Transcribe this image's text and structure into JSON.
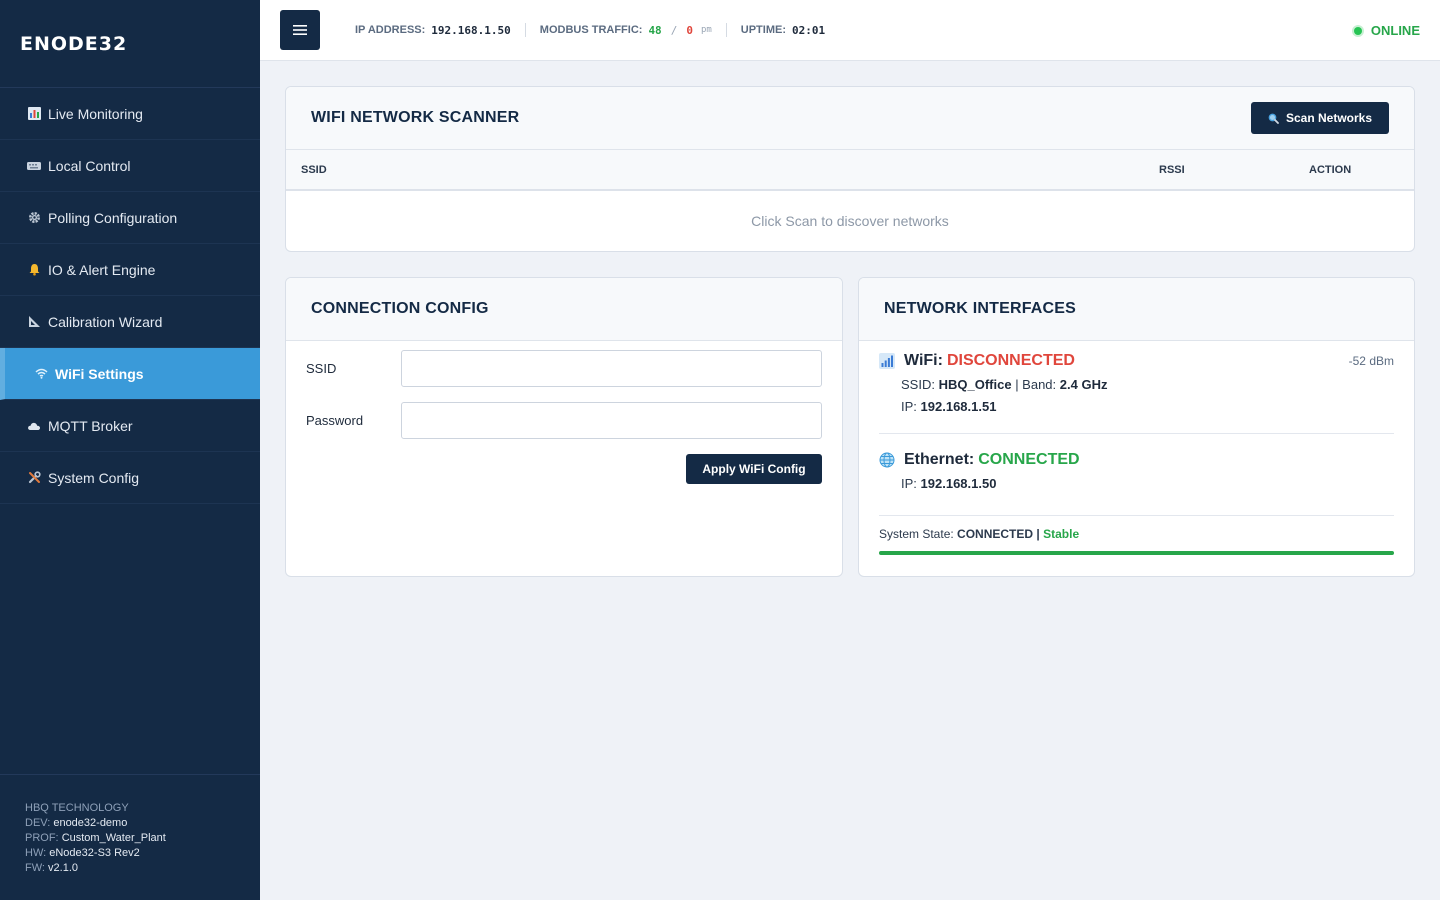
{
  "app": {
    "brand": "ENODE32"
  },
  "sidebar": {
    "items": [
      {
        "label": "Live Monitoring",
        "icon": "bar-chart-icon"
      },
      {
        "label": "Local Control",
        "icon": "keyboard-icon"
      },
      {
        "label": "Polling Configuration",
        "icon": "gear-icon"
      },
      {
        "label": "IO & Alert Engine",
        "icon": "bell-icon"
      },
      {
        "label": "Calibration Wizard",
        "icon": "triangle-ruler-icon"
      },
      {
        "label": "WiFi Settings",
        "icon": "wifi-icon",
        "active": true
      },
      {
        "label": "MQTT Broker",
        "icon": "cloud-icon"
      },
      {
        "label": "System Config",
        "icon": "tools-icon"
      }
    ],
    "footer": {
      "company": "HBQ TECHNOLOGY",
      "dev_label": "DEV:",
      "dev_value": "enode32-demo",
      "prof_label": "PROF:",
      "prof_value": "Custom_Water_Plant",
      "hw_label": "HW:",
      "hw_value": "eNode32-S3 Rev2",
      "fw_label": "FW:",
      "fw_value": "v2.1.0"
    }
  },
  "topbar": {
    "menu_icon": "hamburger-icon",
    "ip_label": "IP ADDRESS:",
    "ip_value": "192.168.1.50",
    "modbus_label": "MODBUS TRAFFIC:",
    "modbus_ok": "48",
    "modbus_slash": "/",
    "modbus_err": "0",
    "modbus_unit": "pm",
    "uptime_label": "UPTIME:",
    "uptime_value": "02:01",
    "status": "ONLINE",
    "status_color": "#27a64a"
  },
  "scanner": {
    "title": "WIFI NETWORK SCANNER",
    "scan_button": "Scan Networks",
    "columns": {
      "ssid": "SSID",
      "rssi": "RSSI",
      "action": "ACTION"
    },
    "empty_message": "Click Scan to discover networks"
  },
  "connection": {
    "title": "CONNECTION CONFIG",
    "ssid_label": "SSID",
    "ssid_value": "",
    "password_label": "Password",
    "password_value": "",
    "apply_button": "Apply WiFi Config"
  },
  "interfaces": {
    "title": "NETWORK INTERFACES",
    "wifi": {
      "name": "WiFi:",
      "status": "DISCONNECTED",
      "rssi": "-52 dBm",
      "ssid_label": "SSID:",
      "ssid_value": "HBQ_Office",
      "band_sep": "| Band:",
      "band_value": "2.4 GHz",
      "ip_label": "IP:",
      "ip_value": "192.168.1.51"
    },
    "ethernet": {
      "name": "Ethernet:",
      "status": "CONNECTED",
      "ip_label": "IP:",
      "ip_value": "192.168.1.50"
    },
    "system_state_label": "System State:",
    "system_state_value": "CONNECTED",
    "system_state_sep": "|",
    "system_state_quality": "Stable",
    "health_percent": 100,
    "colors": {
      "accent": "#142a45",
      "active": "#3a9ad9",
      "success": "#27a64a",
      "danger": "#e0463c"
    }
  }
}
